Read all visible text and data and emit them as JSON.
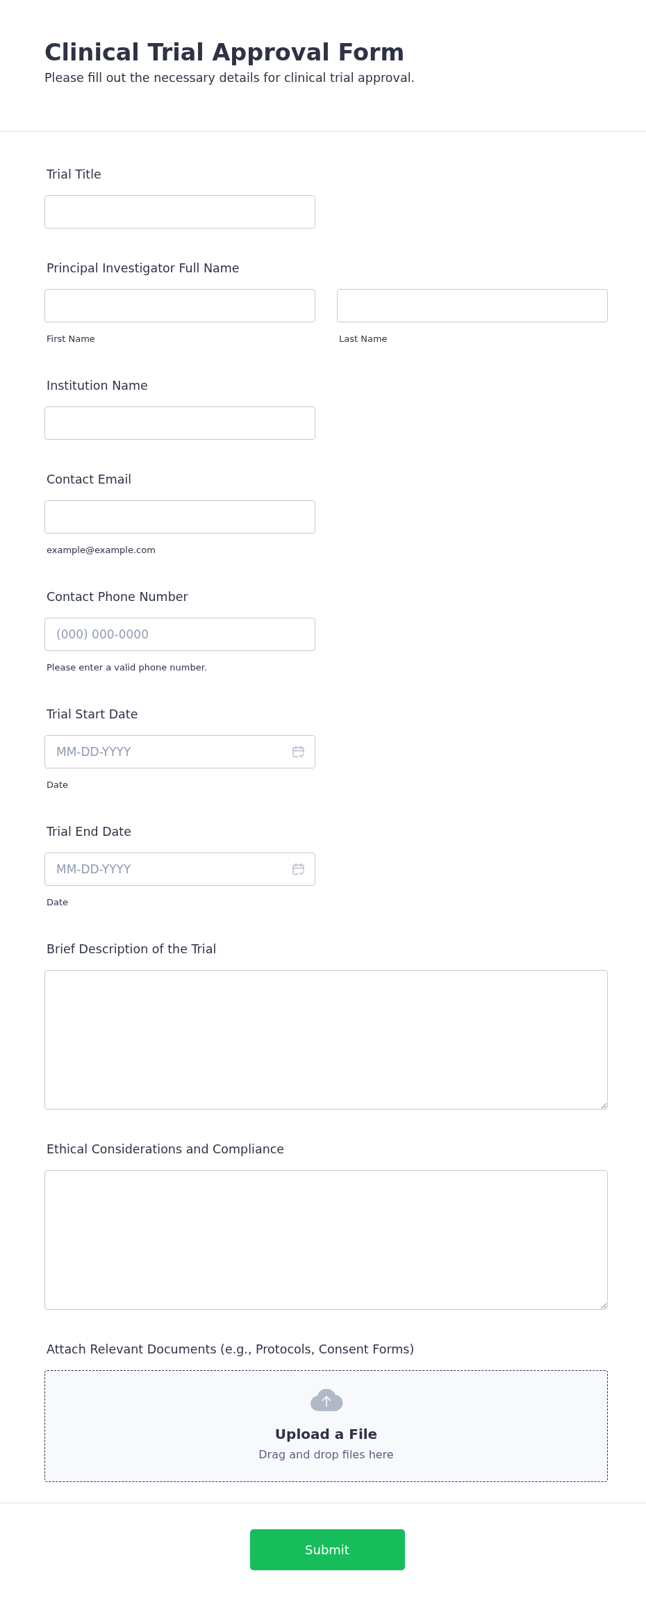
{
  "header": {
    "title": "Clinical Trial Approval Form",
    "subtitle": "Please fill out the necessary details for clinical trial approval."
  },
  "fields": [
    {
      "kind": "text",
      "label": "Trial Title"
    },
    {
      "kind": "name",
      "label": "Principal Investigator Full Name",
      "parts": [
        {
          "sublabel": "First Name"
        },
        {
          "sublabel": "Last Name"
        }
      ]
    },
    {
      "kind": "text",
      "label": "Institution Name"
    },
    {
      "kind": "text",
      "label": "Contact Email",
      "sublabel": "example@example.com"
    },
    {
      "kind": "text",
      "label": "Contact Phone Number",
      "placeholder": "(000) 000-0000",
      "sublabel": "Please enter a valid phone number."
    },
    {
      "kind": "date",
      "label": "Trial Start Date",
      "placeholder": "MM-DD-YYYY",
      "sublabel": "Date"
    },
    {
      "kind": "date",
      "label": "Trial End Date",
      "placeholder": "MM-DD-YYYY",
      "sublabel": "Date"
    },
    {
      "kind": "textarea",
      "label": "Brief Description of the Trial"
    },
    {
      "kind": "textarea",
      "label": "Ethical Considerations and Compliance"
    },
    {
      "kind": "upload",
      "label": "Attach Relevant Documents (e.g., Protocols, Consent Forms)",
      "title": "Upload a File",
      "hint": "Drag and drop files here"
    }
  ],
  "submit": {
    "label": "Submit"
  }
}
